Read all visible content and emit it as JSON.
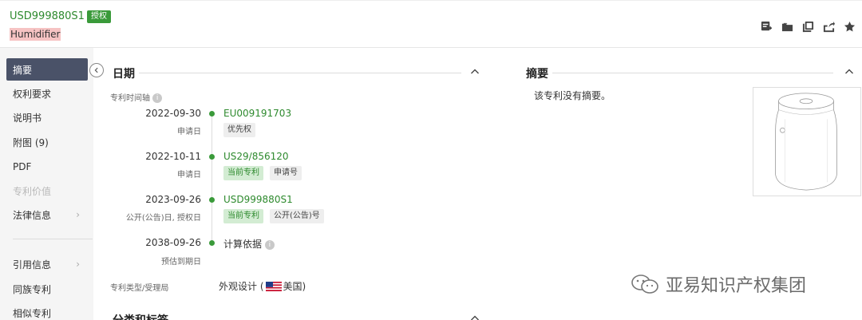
{
  "header": {
    "publication_number": "USD999880S1",
    "status_badge": "授权",
    "title": "Humidifier",
    "tools": [
      "add-note-icon",
      "folder-icon",
      "copy-icon",
      "share-icon",
      "star-icon"
    ]
  },
  "sidebar": {
    "items": [
      {
        "label": "摘要",
        "active": true
      },
      {
        "label": "权利要求"
      },
      {
        "label": "说明书"
      },
      {
        "label": "附图 (9)"
      },
      {
        "label": "PDF"
      },
      {
        "label": "专利价值",
        "disabled": true
      },
      {
        "label": "法律信息",
        "chevron": "›"
      },
      {
        "label": "引用信息",
        "chevron": "›"
      },
      {
        "label": "同族专利"
      },
      {
        "label": "相似专利"
      }
    ]
  },
  "dates_section": {
    "title": "日期",
    "timeline_label": "专利时间轴",
    "events": [
      {
        "date": "2022-09-30",
        "sub": "申请日",
        "number": "EU009191703",
        "tags": [
          "优先权"
        ]
      },
      {
        "date": "2022-10-11",
        "sub": "申请日",
        "number": "US29/856120",
        "tags": [
          "当前专利",
          "申请号"
        ]
      },
      {
        "date": "2023-09-26",
        "sub": "公开(公告)日, 授权日",
        "number": "USD999880S1",
        "tags": [
          "当前专利",
          "公开(公告)号"
        ]
      },
      {
        "date": "2038-09-26",
        "sub": "预估到期日",
        "calc_label": "计算依据"
      }
    ],
    "type_label": "专利类型/受理局",
    "type_value": "外观设计 (",
    "country": "美国)"
  },
  "next_section": {
    "title": "分类和标签"
  },
  "abstract_section": {
    "title": "摘要",
    "text": "该专利没有摘要。"
  },
  "watermark": {
    "text": "亚易知识产权集团"
  },
  "colors": {
    "accent_green": "#2e8a2e",
    "active_nav": "#4a5268",
    "highlight": "#f6c3c3"
  }
}
